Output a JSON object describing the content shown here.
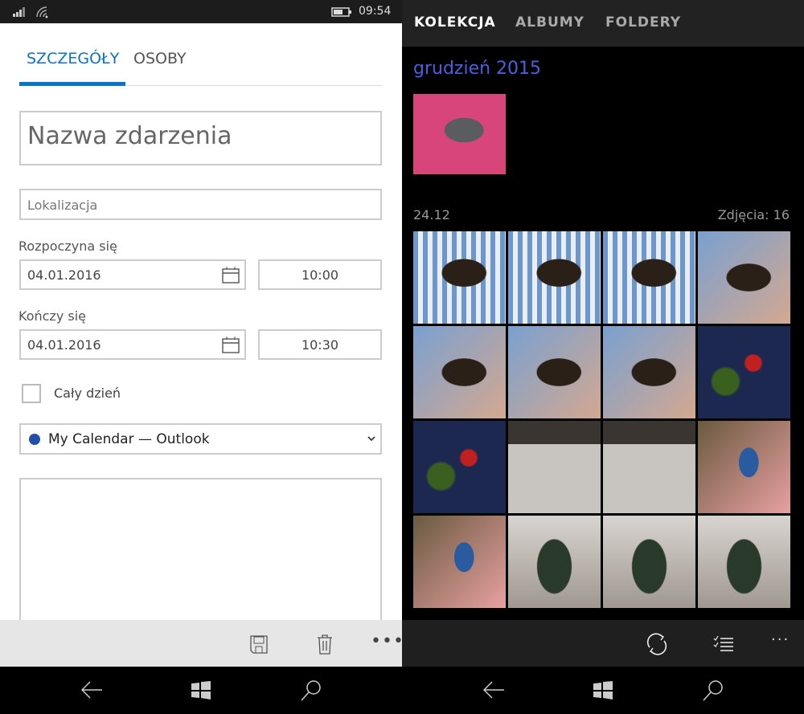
{
  "status": {
    "time": "09:54"
  },
  "event": {
    "tabs": [
      {
        "label": "SZCZEGÓŁY",
        "active": true
      },
      {
        "label": "OSOBY",
        "active": false
      }
    ],
    "title_placeholder": "Nazwa zdarzenia",
    "location_placeholder": "Lokalizacja",
    "start_label": "Rozpoczyna się",
    "start_date": "04.01.2016",
    "start_time": "10:00",
    "end_label": "Kończy się",
    "end_date": "04.01.2016",
    "end_time": "10:30",
    "all_day_label": "Cały dzień",
    "all_day_checked": false,
    "calendar": "My Calendar — Outlook",
    "calendar_color": "#1f4fa8",
    "accent": "#0a74c9"
  },
  "photos": {
    "tabs": [
      {
        "label": "KOLEKCJA",
        "active": true
      },
      {
        "label": "ALBUMY"
      },
      {
        "label": "FOLDERY"
      }
    ],
    "month": "grudzień 2015",
    "day": "24.12",
    "count": "Zdjęcia: 16",
    "accent": "#4a5fe0"
  },
  "icons": {
    "save": "save-icon",
    "delete": "trash-icon",
    "more": "more-icon",
    "sync": "sync-icon",
    "select": "select-icon",
    "back": "back-icon",
    "windows": "windows-icon",
    "search": "search-icon"
  }
}
